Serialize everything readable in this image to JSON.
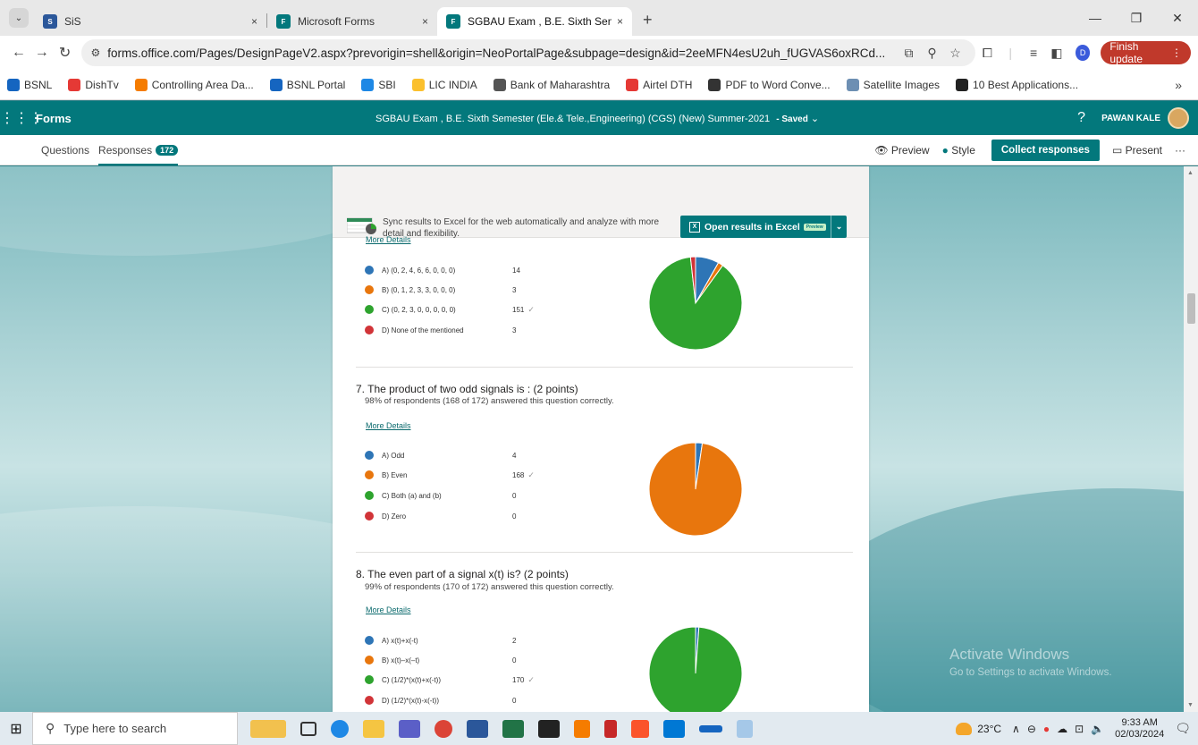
{
  "browser": {
    "tabs": [
      {
        "label": "SiS",
        "close": "×",
        "icon_color": "#2b579a",
        "icon_text": "S"
      },
      {
        "label": "Microsoft Forms",
        "close": "×",
        "icon_color": "#03787c",
        "icon_text": "F"
      },
      {
        "label": "SGBAU Exam , B.E. Sixth Semest",
        "close": "×",
        "icon_color": "#03787c",
        "icon_text": "F"
      }
    ],
    "new_tab": "+",
    "url": "forms.office.com/Pages/DesignPageV2.aspx?prevorigin=shell&origin=NeoPortalPage&subpage=design&id=2eeMFN4esU2uh_fUGVAS6oxRCd...",
    "profile_letter": "D",
    "finish_update": "Finish update"
  },
  "bookmarks": [
    {
      "label": "BSNL",
      "color": "#1565c0"
    },
    {
      "label": "DishTv",
      "color": "#e53935"
    },
    {
      "label": "Controlling Area Da...",
      "color": "#f57c00"
    },
    {
      "label": "BSNL Portal",
      "color": "#1565c0"
    },
    {
      "label": "SBI",
      "color": "#1e88e5"
    },
    {
      "label": "LIC INDIA",
      "color": "#fbc02d"
    },
    {
      "label": "Bank of Maharashtra",
      "color": "#555555"
    },
    {
      "label": "Airtel DTH",
      "color": "#e53935"
    },
    {
      "label": "PDF to Word Conve...",
      "color": "#333333"
    },
    {
      "label": "Satellite Images",
      "color": "#6d8fb3"
    },
    {
      "label": "10 Best Applications...",
      "color": "#222222"
    }
  ],
  "forms": {
    "brand": "Forms",
    "title": "SGBAU Exam , B.E. Sixth Semester (Ele.& Tele.,Engineering) (CGS) (New) Summer-2021",
    "saved": "-  Saved",
    "help": "?",
    "user": "PAWAN KALE",
    "tabs": {
      "questions": "Questions",
      "responses": "Responses",
      "responses_count": "172"
    },
    "actions": {
      "preview": "Preview",
      "style": "Style",
      "collect": "Collect responses",
      "present": "Present",
      "more": "···"
    }
  },
  "sync": {
    "text": "Sync results to Excel for the web automatically and analyze with more detail and flexibility.",
    "button": "Open results in Excel",
    "preview_tag": "Preview"
  },
  "colors": {
    "blue": "#2e75b6",
    "orange": "#e8760d",
    "green": "#2ea32e",
    "red": "#d13438",
    "teal": "#03787c"
  },
  "questions": [
    {
      "title": "",
      "summary": "",
      "more": "More Details",
      "options": [
        {
          "label": "A) (0, 2, 4, 6, 6, 0, 0, 0)",
          "count": "14",
          "value": 14,
          "color": "#2e75b6",
          "correct": false
        },
        {
          "label": "B) (0, 1, 2, 3, 3, 0, 0, 0)",
          "count": "3",
          "value": 3,
          "color": "#e8760d",
          "correct": false
        },
        {
          "label": "C) (0, 2, 3, 0, 0, 0, 0, 0)",
          "count": "151",
          "value": 151,
          "color": "#2ea32e",
          "correct": true
        },
        {
          "label": "D) None of the mentioned",
          "count": "3",
          "value": 3,
          "color": "#d13438",
          "correct": false
        }
      ]
    },
    {
      "title": "7. The product of two odd signals is : (2 points)",
      "summary": "98% of respondents (168 of 172) answered this question correctly.",
      "more": "More Details",
      "options": [
        {
          "label": "A) Odd",
          "count": "4",
          "value": 4,
          "color": "#2e75b6",
          "correct": false
        },
        {
          "label": "B) Even",
          "count": "168",
          "value": 168,
          "color": "#e8760d",
          "correct": true
        },
        {
          "label": "C) Both (a) and (b)",
          "count": "0",
          "value": 0,
          "color": "#2ea32e",
          "correct": false
        },
        {
          "label": "D) Zero",
          "count": "0",
          "value": 0,
          "color": "#d13438",
          "correct": false
        }
      ]
    },
    {
      "title": "8. The even part of a signal x(t) is? (2 points)",
      "summary": "99% of respondents (170 of 172) answered this question correctly.",
      "more": "More Details",
      "options": [
        {
          "label": "A) x(t)+x(-t)",
          "count": "2",
          "value": 2,
          "color": "#2e75b6",
          "correct": false
        },
        {
          "label": "B) x(t)–x(–t)",
          "count": "0",
          "value": 0,
          "color": "#e8760d",
          "correct": false
        },
        {
          "label": "C) (1/2)*(x(t)+x(-t))",
          "count": "170",
          "value": 170,
          "color": "#2ea32e",
          "correct": true
        },
        {
          "label": "D) (1/2)*(x(t)-x(-t))",
          "count": "0",
          "value": 0,
          "color": "#d13438",
          "correct": false
        }
      ]
    }
  ],
  "watermark": {
    "line1": "Activate Windows",
    "line2": "Go to Settings to activate Windows."
  },
  "taskbar": {
    "search_placeholder": "Type here to search",
    "temperature": "23°C",
    "time": "9:33 AM",
    "date": "02/03/2024"
  }
}
